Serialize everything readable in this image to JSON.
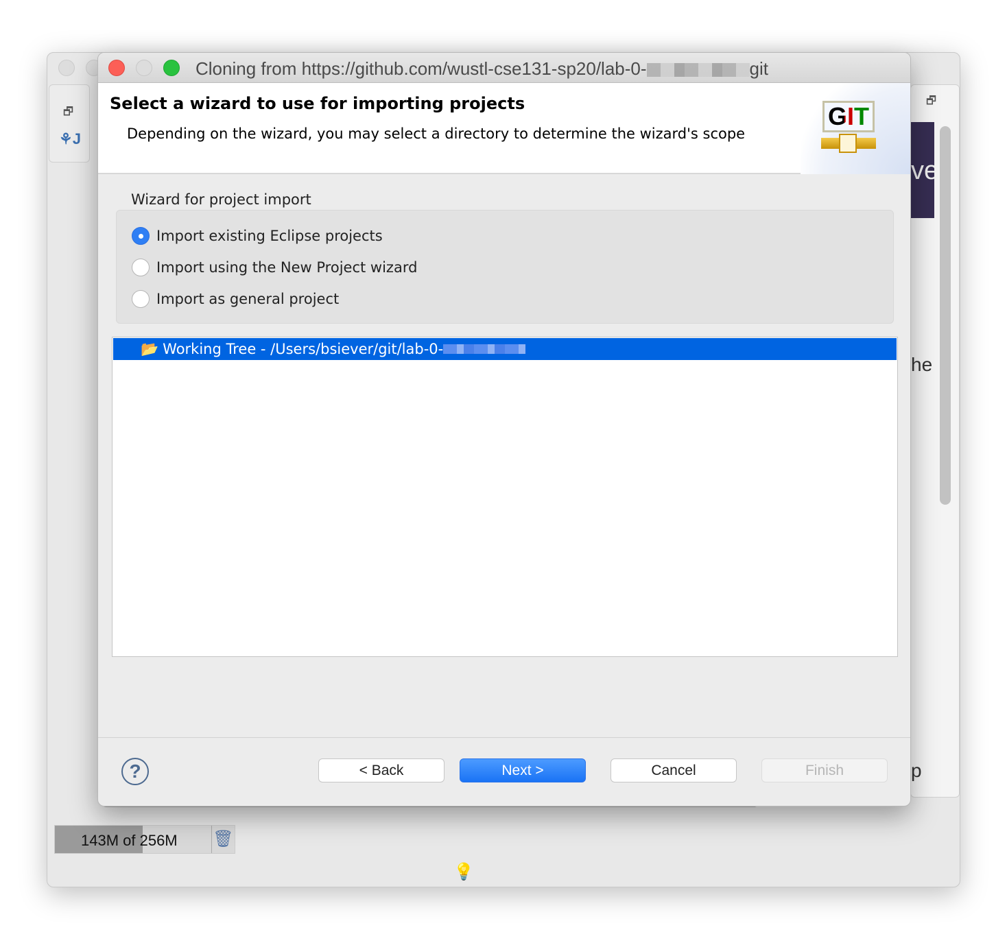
{
  "window": {
    "title": "Cloning from https://github.com/wustl-cse131-sp20/lab-0-",
    "title_suffix": "git"
  },
  "header": {
    "title": "Select a wizard to use for importing projects",
    "description": "Depending on the wizard, you may select a directory to determine the wizard's scope",
    "logo_text": "GIT"
  },
  "wizard_group": {
    "label": "Wizard for project import",
    "options": [
      {
        "label": "Import existing Eclipse projects",
        "selected": true
      },
      {
        "label": "Import using the New Project wizard",
        "selected": false
      },
      {
        "label": "Import as general project",
        "selected": false
      }
    ]
  },
  "tree": {
    "selected_item": "Working Tree - /Users/bsiever/git/lab-0-"
  },
  "buttons": {
    "back": "< Back",
    "next": "Next >",
    "cancel": "Cancel",
    "finish": "Finish",
    "finish_enabled": false
  },
  "background": {
    "fragments": [
      "ve",
      "he",
      "p"
    ]
  },
  "status": {
    "memory": "143M of 256M",
    "memory_used_fraction": 0.56
  },
  "colors": {
    "selection": "#0064e1",
    "primary_button": "#1a73f5"
  }
}
